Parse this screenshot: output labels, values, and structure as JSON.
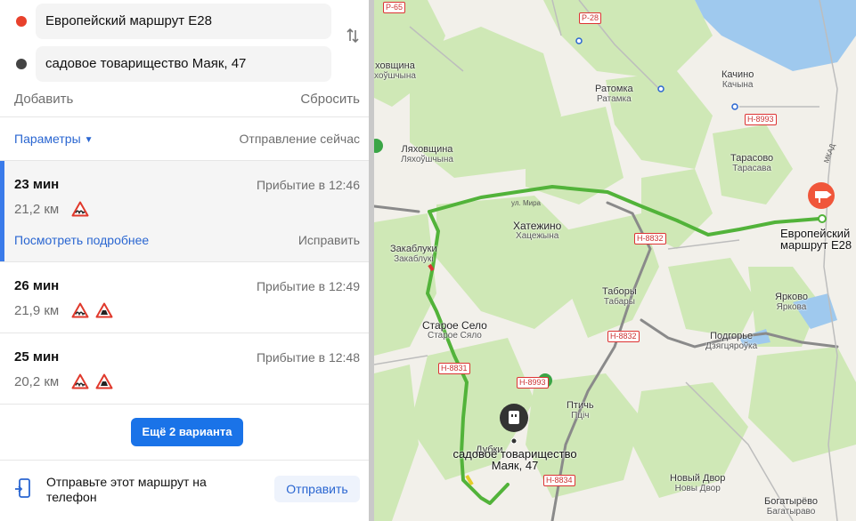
{
  "waypoints": [
    {
      "value": "Европейский маршрут E28",
      "dot_color": "#e8412c"
    },
    {
      "value": "садовое товарищество Маяк, 47",
      "dot_color": "#444444"
    }
  ],
  "actions": {
    "add": "Добавить",
    "reset": "Сбросить"
  },
  "params": {
    "label": "Параметры",
    "departure": "Отправление сейчас"
  },
  "routes": [
    {
      "time": "23 мин",
      "distance": "21,2 км",
      "arrival": "Прибытие в 12:46",
      "signs": [
        "bumps-sign"
      ],
      "details": "Посмотреть подробнее",
      "fix": "Исправить",
      "active": true
    },
    {
      "time": "26 мин",
      "distance": "21,9 км",
      "arrival": "Прибытие в 12:49",
      "signs": [
        "bumps-sign",
        "unpaved-sign"
      ]
    },
    {
      "time": "25 мин",
      "distance": "20,2 км",
      "arrival": "Прибытие в 12:48",
      "signs": [
        "bumps-sign",
        "unpaved-sign"
      ]
    }
  ],
  "more_variants": "Ещё 2 варианта",
  "send": {
    "text": "Отправьте этот маршрут на телефон",
    "button": "Отправить",
    "icon": "phone-send-icon"
  },
  "map": {
    "route_color": "#52b33a",
    "places": [
      {
        "name": "Ратомка",
        "sub": "Ратамка"
      },
      {
        "name": "Качино",
        "sub": "Качына"
      },
      {
        "name": "Ляховщина",
        "sub": "Ляхоўшчына"
      },
      {
        "name": "ховщина",
        "sub": "хоўшчына"
      },
      {
        "name": "Тарасово",
        "sub": "Тарасава"
      },
      {
        "name": "Хатежино",
        "sub": "Хацежына"
      },
      {
        "name": "Закаблуки",
        "sub": "Закаблукі"
      },
      {
        "name": "Таборы",
        "sub": "Табары"
      },
      {
        "name": "Ярково",
        "sub": "Яркова"
      },
      {
        "name": "Старое Село",
        "sub": "Старое Сяло"
      },
      {
        "name": "Подгорье",
        "sub": "Дзягцяроўка"
      },
      {
        "name": "Птичь",
        "sub": "Пціч"
      },
      {
        "name": "Новый Двор",
        "sub": "Новы Двор"
      },
      {
        "name": "Богатырёво",
        "sub": "Багатыраво"
      },
      {
        "name": "Дубки",
        "sub": ""
      }
    ],
    "road_labels": [
      "Р-65",
      "Р-28",
      "Н-8993",
      "Н-8832",
      "Н-8832",
      "Н-8831",
      "Н-8993",
      "Н-8834"
    ],
    "street_labels": [
      "ул. Мира",
      "МКАД"
    ],
    "destination_label": "Европейский маршрут E28",
    "origin_label": "садовое товарищество Маяк, 47"
  }
}
